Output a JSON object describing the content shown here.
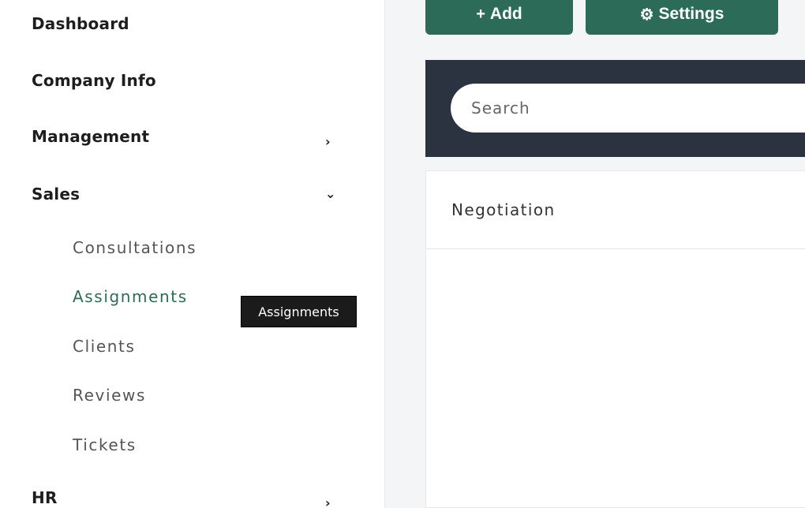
{
  "sidebar": {
    "items": [
      {
        "label": "Dashboard"
      },
      {
        "label": "Company Info"
      },
      {
        "label": "Management",
        "chevron": "›"
      },
      {
        "label": "Sales",
        "chevron": "⌄"
      },
      {
        "label": "HR",
        "chevron": "›"
      }
    ],
    "sales_sub": [
      {
        "label": "Consultations"
      },
      {
        "label": "Assignments",
        "active": true
      },
      {
        "label": "Clients"
      },
      {
        "label": "Reviews"
      },
      {
        "label": "Tickets"
      }
    ],
    "tooltip": "Assignments"
  },
  "toolbar": {
    "add_label": "Add",
    "add_icon": "+",
    "settings_label": "Settings",
    "settings_icon": "⚙"
  },
  "search": {
    "placeholder": "Search"
  },
  "panel": {
    "title": "Negotiation"
  },
  "colors": {
    "accent": "#2c6b58",
    "searchbar_bg": "#2b3340",
    "active_item": "#2f6b56"
  }
}
